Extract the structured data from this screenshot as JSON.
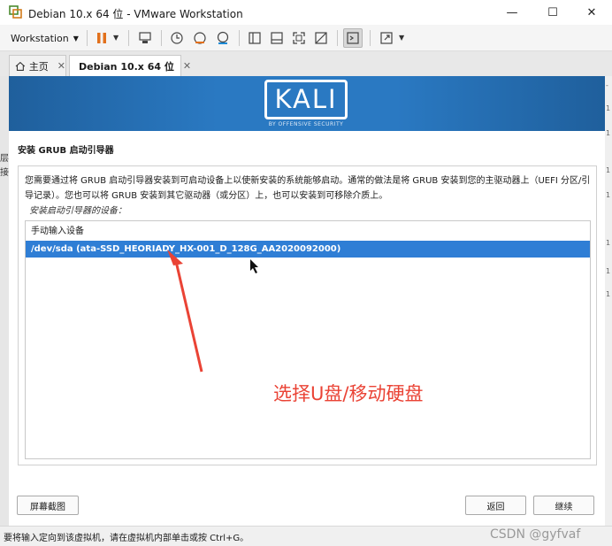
{
  "window": {
    "title": "Debian 10.x 64 位 - VMware Workstation",
    "minimize_glyph": "—",
    "maximize_glyph": "☐",
    "close_glyph": "✕"
  },
  "toolbar": {
    "workstation_menu_label": "Workstation",
    "icons": [
      "pause-icon",
      "send-ctrl-alt-del-icon",
      "snapshot-icon",
      "revert-snapshot-icon",
      "manage-snapshots-icon",
      "sidebar-view-icon",
      "thumbnail-view-icon",
      "fullscreen-icon",
      "unity-icon",
      "console-view-icon",
      "stretch-guest-icon"
    ]
  },
  "tabs": [
    {
      "label": "主页",
      "close": "✕",
      "icon": "home-icon"
    },
    {
      "label": "Debian 10.x 64 位",
      "close": "✕",
      "icon": "vm-icon"
    }
  ],
  "left_edge_chars": [
    "层",
    "接"
  ],
  "right_edge_chars": [
    "-",
    "1",
    "1",
    "1",
    "1",
    "1",
    "1",
    "1"
  ],
  "installer": {
    "logo_text": "KALI",
    "logo_tagline": "BY OFFENSIVE SECURITY",
    "step_title": "安装 GRUB 启动引导器",
    "description": "您需要通过将 GRUB 启动引导器安装到可启动设备上以使新安装的系统能够启动。通常的做法是将 GRUB 安装到您的主驱动器上（UEFI 分区/引导记录）。您也可以将 GRUB 安装到其它驱动器（或分区）上，也可以安装到可移除介质上。",
    "device_list_label": "安装启动引导器的设备：",
    "options": [
      {
        "label": "手动输入设备",
        "selected": false
      },
      {
        "label": "/dev/sda  (ata-SSD_HEORIADY_HX-001_D_128G_AA2020092000)",
        "selected": true
      }
    ],
    "screenshot_button": "屏幕截图",
    "back_button": "返回",
    "continue_button": "继续",
    "selection_color": "#2f7ed5",
    "banner_color": "#2a79c2"
  },
  "annotation": {
    "note_text": "选择U盘/移动硬盘",
    "color": "#ea4335"
  },
  "statusbar": {
    "text": "要将输入定向到该虚拟机，请在虚拟机内部单击或按 Ctrl+G。",
    "watermark": "CSDN @gyfvaf"
  }
}
